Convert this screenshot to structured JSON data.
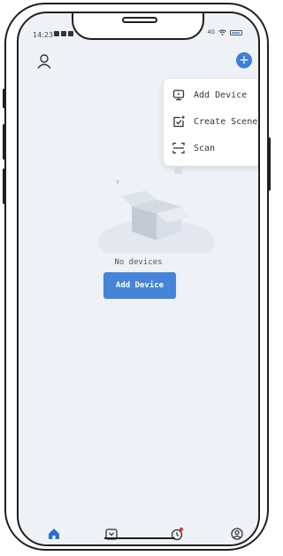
{
  "status_bar": {
    "time": "14:23",
    "network": "4G"
  },
  "header": {
    "profile_icon": "person-outline-icon",
    "add_icon": "plus-circle-icon"
  },
  "menu": {
    "items": [
      {
        "label": "Add Device",
        "icon": "add-device-icon"
      },
      {
        "label": "Create Scene",
        "icon": "create-scene-icon"
      },
      {
        "label": "Scan",
        "icon": "scan-icon"
      }
    ]
  },
  "empty_state": {
    "message": "No devices",
    "button_label": "Add Device",
    "illustration": "empty-box-icon"
  },
  "tabbar": {
    "tabs": [
      {
        "name": "home",
        "icon": "home-icon",
        "active": true
      },
      {
        "name": "scenes",
        "icon": "scenes-icon",
        "active": false
      },
      {
        "name": "smart",
        "icon": "smart-icon",
        "active": false
      },
      {
        "name": "profile",
        "icon": "profile-icon",
        "active": false
      }
    ]
  },
  "colors": {
    "accent": "#3d7fd6",
    "background": "#eef1f5",
    "badge": "#e53935"
  }
}
